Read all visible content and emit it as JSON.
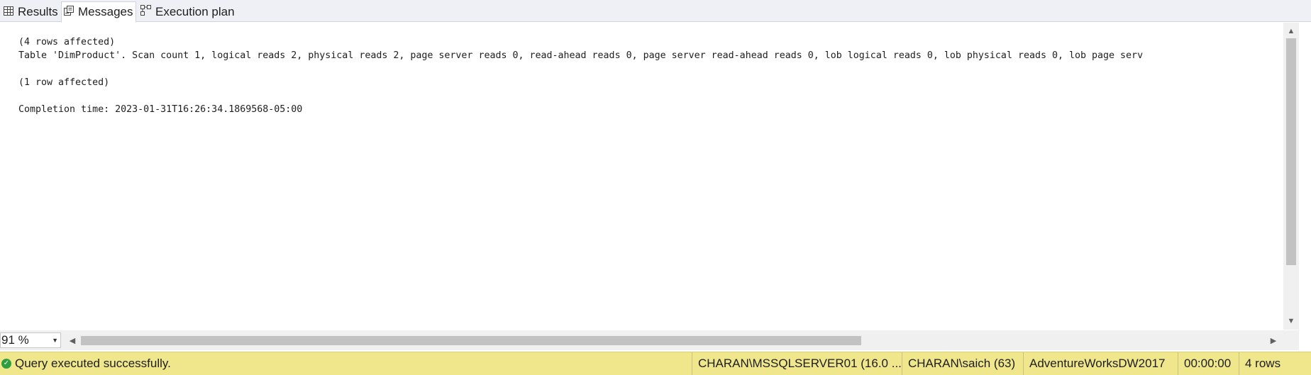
{
  "tabs": [
    {
      "label": "Results",
      "icon": "grid-icon",
      "active": false
    },
    {
      "label": "Messages",
      "icon": "messages-icon",
      "active": true
    },
    {
      "label": "Execution plan",
      "icon": "execution-plan-icon",
      "active": false
    }
  ],
  "messages": {
    "lines": [
      "(4 rows affected)",
      "Table 'DimProduct'. Scan count 1, logical reads 2, physical reads 2, page server reads 0, read-ahead reads 0, page server read-ahead reads 0, lob logical reads 0, lob physical reads 0, lob page serv",
      "(1 row affected)",
      "Completion time: 2023-01-31T16:26:34.1869568-05:00"
    ]
  },
  "zoom": {
    "value": "91 %"
  },
  "status": {
    "message": "Query executed successfully.",
    "server": "CHARAN\\MSSQLSERVER01 (16.0 ...",
    "user": "CHARAN\\saich (63)",
    "database": "AdventureWorksDW2017",
    "elapsed": "00:00:00",
    "rows": "4 rows",
    "color": "#f0e68c",
    "icon": "check-circle-icon"
  }
}
